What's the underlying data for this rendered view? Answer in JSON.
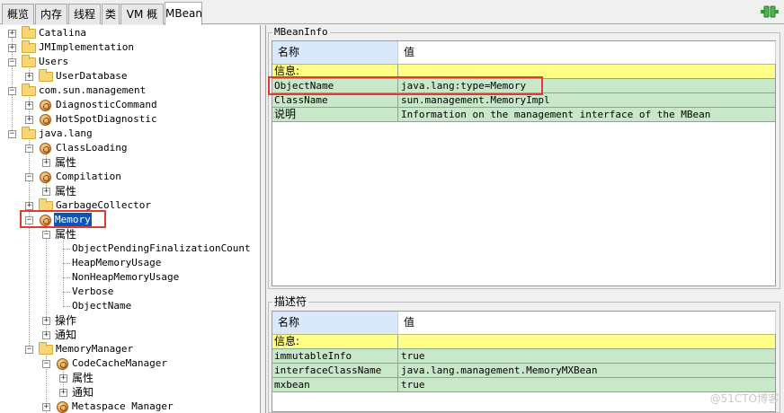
{
  "tabs": [
    {
      "label": "概览"
    },
    {
      "label": "内存"
    },
    {
      "label": "线程"
    },
    {
      "label": "类"
    },
    {
      "label": "VM 概要"
    },
    {
      "label": "MBean"
    }
  ],
  "tree": {
    "nodes": [
      {
        "label": "Catalina"
      },
      {
        "label": "JMImplementation"
      },
      {
        "label": "Users"
      },
      {
        "label": "UserDatabase"
      },
      {
        "label": "com.sun.management"
      },
      {
        "label": "DiagnosticCommand"
      },
      {
        "label": "HotSpotDiagnostic"
      },
      {
        "label": "java.lang"
      },
      {
        "label": "ClassLoading"
      },
      {
        "label": "属性"
      },
      {
        "label": "Compilation"
      },
      {
        "label": "属性"
      },
      {
        "label": "GarbageCollector"
      },
      {
        "label": "Memory"
      },
      {
        "label": "属性"
      },
      {
        "label": "ObjectPendingFinalizationCount"
      },
      {
        "label": "HeapMemoryUsage"
      },
      {
        "label": "NonHeapMemoryUsage"
      },
      {
        "label": "Verbose"
      },
      {
        "label": "ObjectName"
      },
      {
        "label": "操作"
      },
      {
        "label": "通知"
      },
      {
        "label": "MemoryManager"
      },
      {
        "label": "CodeCacheManager"
      },
      {
        "label": "属性"
      },
      {
        "label": "通知"
      },
      {
        "label": "Metaspace Manager"
      }
    ]
  },
  "mbean_info": {
    "title": "MBeanInfo",
    "header_name": "名称",
    "header_value": "值",
    "info_label": "信息:",
    "rows": [
      {
        "name": "ObjectName",
        "value": "java.lang:type=Memory"
      },
      {
        "name": "ClassName",
        "value": "sun.management.MemoryImpl"
      },
      {
        "name": "说明",
        "value": "Information on the management interface of the MBean"
      }
    ]
  },
  "descriptor": {
    "title": "描述符",
    "header_name": "名称",
    "header_value": "值",
    "info_label": "信息:",
    "rows": [
      {
        "name": "immutableInfo",
        "value": "true"
      },
      {
        "name": "interfaceClassName",
        "value": "java.lang.management.MemoryMXBean"
      },
      {
        "name": "mxbean",
        "value": "true"
      }
    ]
  },
  "watermark": "@51CTO博客",
  "colors": {
    "selection": "#0a56b8",
    "highlight": "#e53935",
    "info_row": "#ffff88",
    "data_row": "#c9e8c9"
  }
}
